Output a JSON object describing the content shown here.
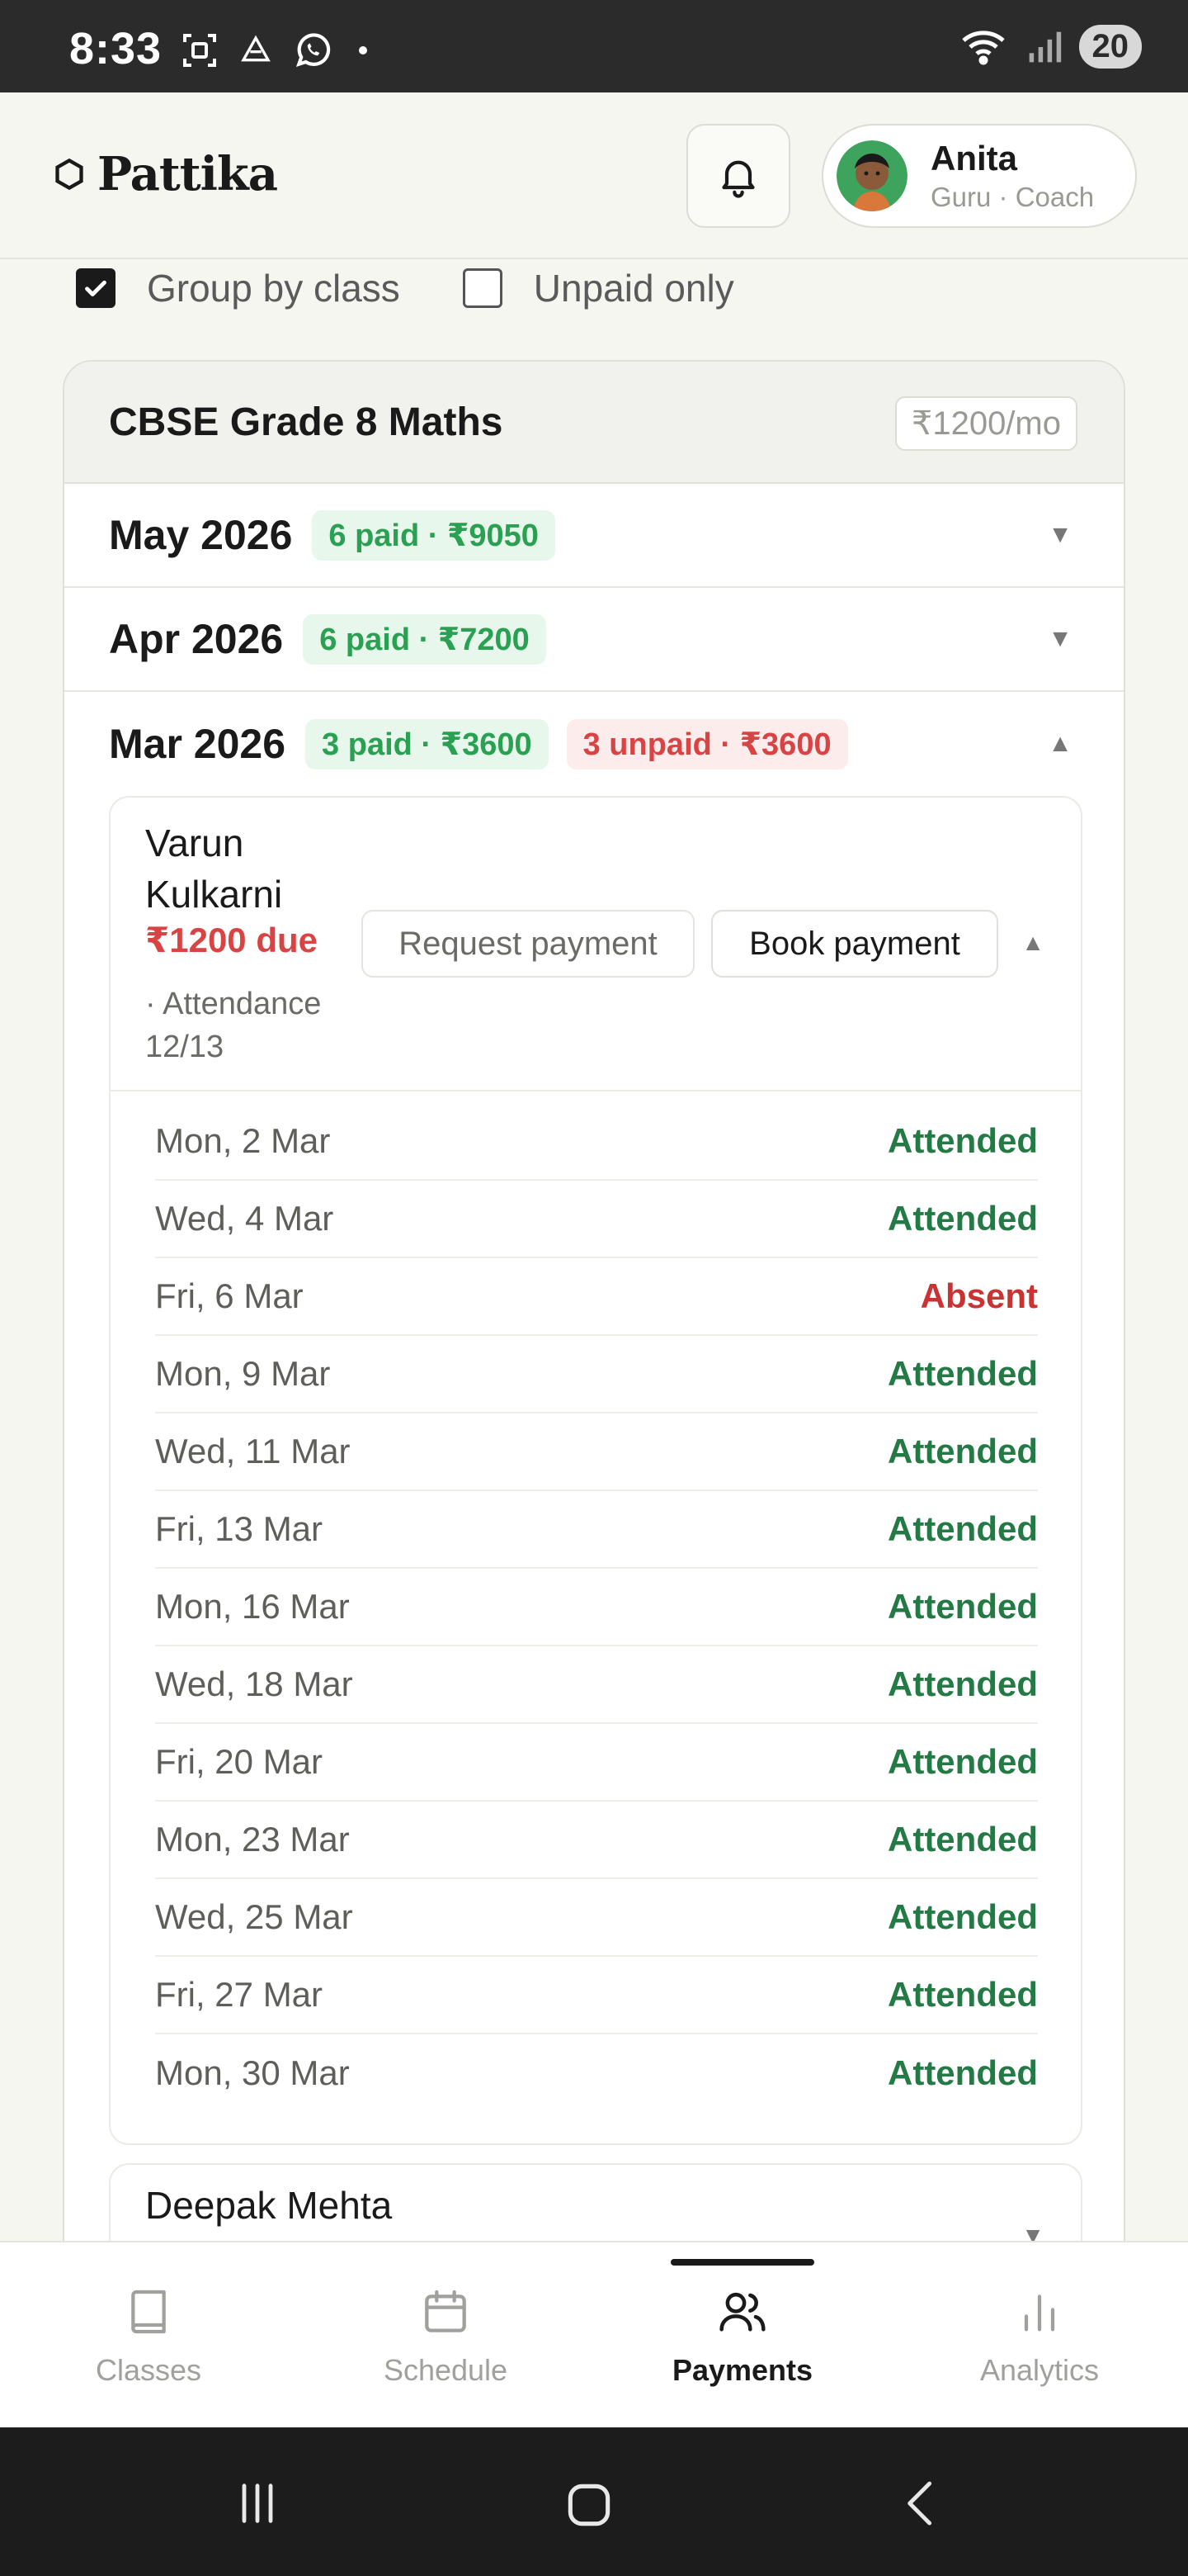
{
  "status_bar": {
    "time": "8:33",
    "battery": "20"
  },
  "header": {
    "app_name": "Pattika",
    "profile": {
      "name": "Anita",
      "role": "Guru · Coach"
    }
  },
  "filters": [
    {
      "label": "Group by class",
      "checked": true
    },
    {
      "label": "Unpaid only",
      "checked": false
    }
  ],
  "class_card": {
    "title": "CBSE Grade 8 Maths",
    "rate": "₹1200/mo",
    "months": [
      {
        "title": "May 2026",
        "paid": "6 paid · ₹9050",
        "chevron": "▼"
      },
      {
        "title": "Apr 2026",
        "paid": "6 paid · ₹7200",
        "chevron": "▼"
      },
      {
        "title": "Mar 2026",
        "paid": "3 paid · ₹3600",
        "unpaid": "3 unpaid · ₹3600",
        "chevron": "▲"
      }
    ],
    "students": [
      {
        "name": "Varun Kulkarni",
        "due": "₹1200 due",
        "attendance": "· Attendance 12/13",
        "request_label": "Request payment",
        "book_label": "Book payment",
        "chevron": "▲",
        "sessions": [
          {
            "date": "Mon, 2 Mar",
            "status": "Attended"
          },
          {
            "date": "Wed, 4 Mar",
            "status": "Attended"
          },
          {
            "date": "Fri, 6 Mar",
            "status": "Absent"
          },
          {
            "date": "Mon, 9 Mar",
            "status": "Attended"
          },
          {
            "date": "Wed, 11 Mar",
            "status": "Attended"
          },
          {
            "date": "Fri, 13 Mar",
            "status": "Attended"
          },
          {
            "date": "Mon, 16 Mar",
            "status": "Attended"
          },
          {
            "date": "Wed, 18 Mar",
            "status": "Attended"
          },
          {
            "date": "Fri, 20 Mar",
            "status": "Attended"
          },
          {
            "date": "Mon, 23 Mar",
            "status": "Attended"
          },
          {
            "date": "Wed, 25 Mar",
            "status": "Attended"
          },
          {
            "date": "Fri, 27 Mar",
            "status": "Attended"
          },
          {
            "date": "Mon, 30 Mar",
            "status": "Attended"
          }
        ]
      },
      {
        "name": "Deepak Mehta",
        "chevron": "▼"
      }
    ]
  },
  "bottom_nav": [
    {
      "label": "Classes",
      "icon": "book-icon",
      "active": false
    },
    {
      "label": "Schedule",
      "icon": "calendar-icon",
      "active": false
    },
    {
      "label": "Payments",
      "icon": "users-icon",
      "active": true
    },
    {
      "label": "Analytics",
      "icon": "bar-chart-icon",
      "active": false
    }
  ],
  "colors": {
    "paid_green": "#2aa052",
    "attended_green": "#237a45",
    "due_red": "#d84444",
    "absent_red": "#c83434"
  }
}
